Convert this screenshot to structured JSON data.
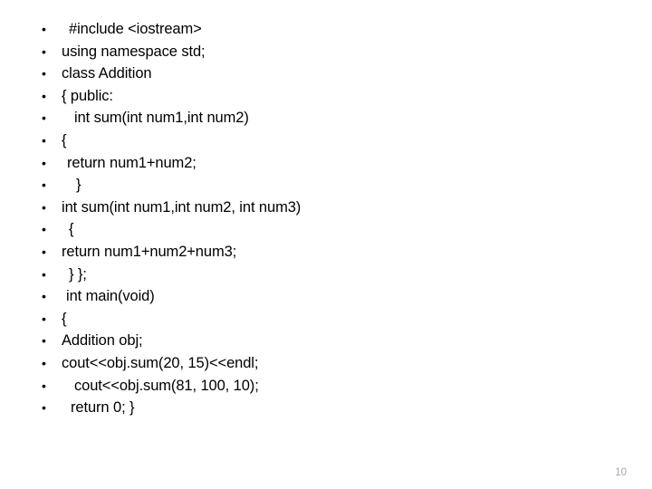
{
  "slide": {
    "background_color": "#ffffff",
    "text_color": "#000000",
    "bullet_glyph": "•",
    "page_number": "10",
    "page_number_color": "#a6a6a6",
    "code_lines": [
      {
        "text": "#include <iostream>",
        "indent": 8
      },
      {
        "text": "using namespace std;",
        "indent": 0
      },
      {
        "text": "class Addition",
        "indent": 0
      },
      {
        "text": "{ public:",
        "indent": 0
      },
      {
        "text": "int sum(int num1,int num2)",
        "indent": 14
      },
      {
        "text": "{",
        "indent": 0
      },
      {
        "text": "return num1+num2;",
        "indent": 6
      },
      {
        "text": "}",
        "indent": 16
      },
      {
        "text": "int sum(int num1,int num2, int num3)",
        "indent": 0
      },
      {
        "text": "{",
        "indent": 8
      },
      {
        "text": "return num1+num2+num3;",
        "indent": 0
      },
      {
        "text": "} };",
        "indent": 8
      },
      {
        "text": "int main(void)",
        "indent": 5
      },
      {
        "text": "{",
        "indent": 0
      },
      {
        "text": "Addition obj;",
        "indent": 0
      },
      {
        "text": "cout<<obj.sum(20, 15)<<endl;",
        "indent": 0
      },
      {
        "text": "cout<<obj.sum(81, 100, 10);",
        "indent": 14
      },
      {
        "text": "return 0; }",
        "indent": 10
      }
    ]
  }
}
